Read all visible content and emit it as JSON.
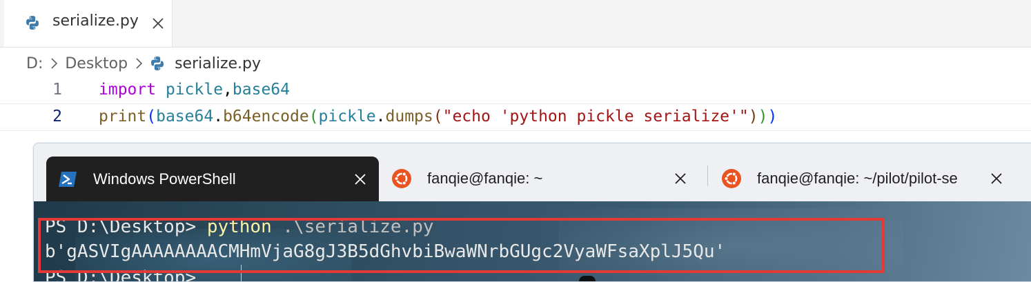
{
  "editor": {
    "tab": {
      "label": "serialize.py",
      "icon": "python-icon",
      "close_icon": "close-icon"
    },
    "breadcrumb": {
      "drive": "D:",
      "folder": "Desktop",
      "file": "serialize.py"
    },
    "lines": [
      {
        "number": "1",
        "tokens": {
          "kw": "import",
          "sp1": " ",
          "mod1": "pickle",
          "comma": ",",
          "mod2": "base64"
        }
      },
      {
        "number": "2",
        "tokens": {
          "fn": "print",
          "p1o": "(",
          "mod": "base64",
          "dot1": ".",
          "fn2": "b64encode",
          "p2o": "(",
          "mod2": "pickle",
          "dot2": ".",
          "fn3": "dumps",
          "p3o": "(",
          "str": "\"echo 'python pickle serialize'\"",
          "p3c": ")",
          "p2c": ")",
          "p1c": ")"
        }
      }
    ]
  },
  "terminal": {
    "tabs": [
      {
        "label": "Windows PowerShell",
        "icon": "powershell-icon",
        "active": true
      },
      {
        "label": "fanqie@fanqie: ~",
        "icon": "ubuntu-icon",
        "active": false
      },
      {
        "label": "fanqie@fanqie: ~/pilot/pilot-se",
        "icon": "ubuntu-icon",
        "active": false
      }
    ],
    "console": {
      "line1_prompt": "PS D:\\Desktop> ",
      "line1_cmd": "python",
      "line1_arg": " .\\serialize.py",
      "line2": "b'gASVIgAAAAAAAACMHmVjaG8gJ3B5dGhvbiBwaWNrbGUgc2VyaWFsaXplJ5Qu'",
      "line3_prompt": "PS D:\\Desktop>"
    }
  },
  "colors": {
    "highlight_border": "#e53935",
    "terminal_active_tab": "#202020",
    "ubuntu_orange": "#e95420",
    "powershell_blue": "#2671be"
  }
}
